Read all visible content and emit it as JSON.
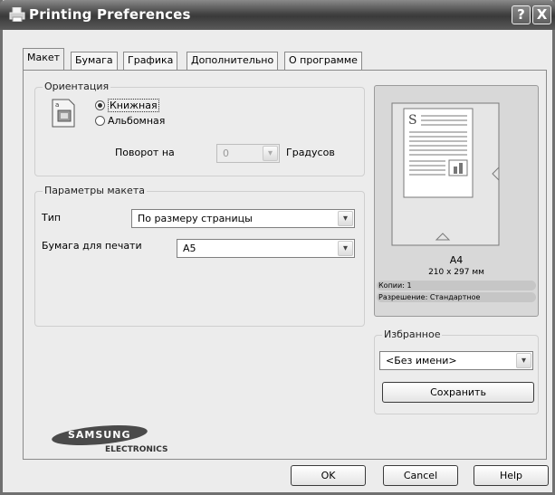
{
  "window": {
    "title": "Printing Preferences",
    "help_label": "?",
    "close_label": "X"
  },
  "tabs": [
    {
      "label": "Макет",
      "active": true
    },
    {
      "label": "Бумага",
      "active": false
    },
    {
      "label": "Графика",
      "active": false
    },
    {
      "label": "Дополнительно",
      "active": false
    },
    {
      "label": "О программе",
      "active": false
    }
  ],
  "orientation": {
    "title": "Ориентация",
    "options": [
      {
        "label": "Книжная",
        "selected": true
      },
      {
        "label": "Альбомная",
        "selected": false
      }
    ],
    "rotate_label": "Поворот на",
    "rotate_value": "0",
    "degrees_label": "Градусов"
  },
  "layout": {
    "title": "Параметры макета",
    "type_label": "Тип",
    "type_value": "По размеру страницы",
    "paper_label": "Бумага для печати",
    "paper_value": "A5"
  },
  "preview": {
    "paper_name": "A4",
    "paper_dims": "210 x 297 мм",
    "copies": "Копии: 1",
    "resolution": "Разрешение: Стандартное"
  },
  "favorites": {
    "title": "Избранное",
    "value": "<Без имени>",
    "save_label": "Сохранить"
  },
  "brand": {
    "name": "SAMSUNG",
    "sub": "ELECTRONICS"
  },
  "footer": {
    "ok_label": "OK",
    "cancel_label": "Cancel",
    "help_label": "Help"
  }
}
